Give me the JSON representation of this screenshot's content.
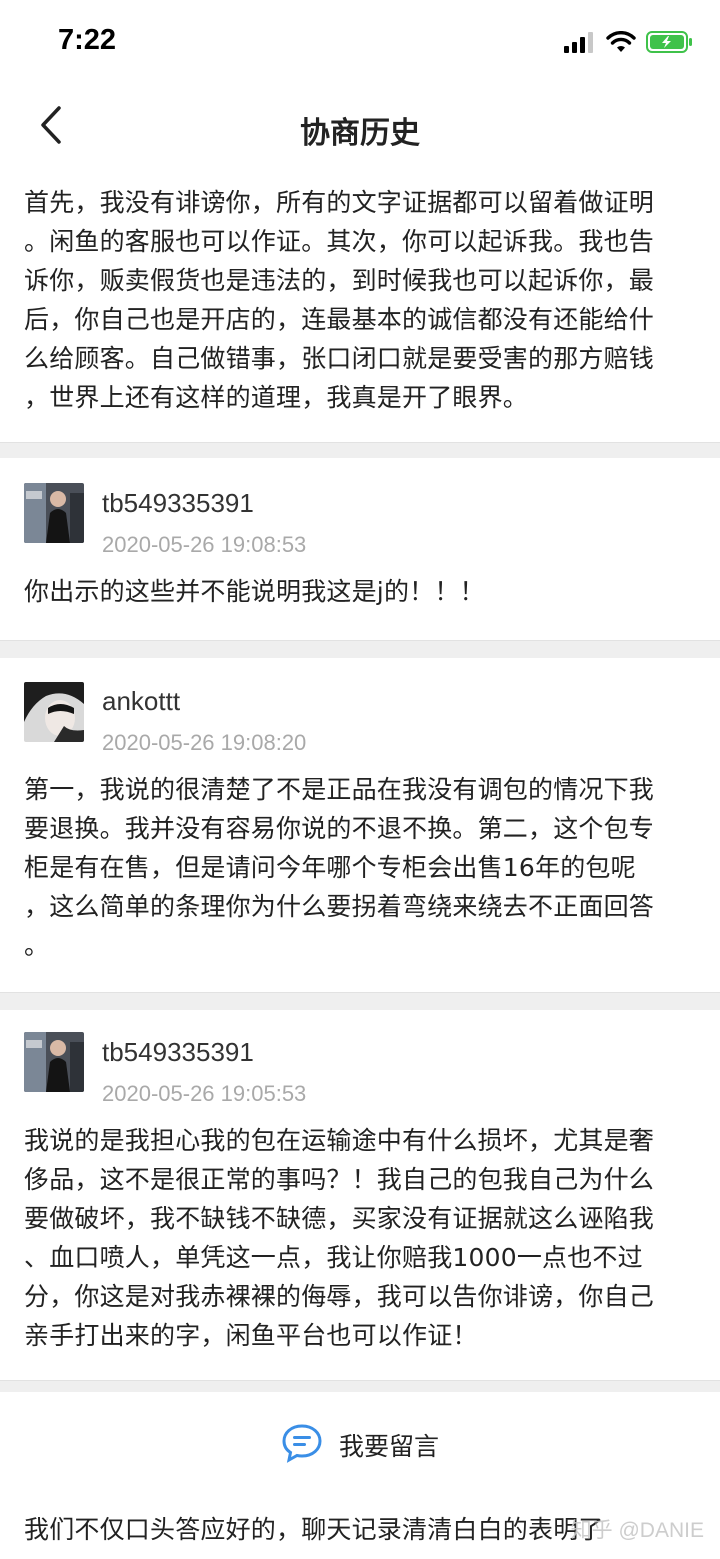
{
  "status_bar": {
    "time": "7:22",
    "signal_icon": "cellular-signal-icon",
    "wifi_icon": "wifi-icon",
    "battery_icon": "battery-charging-icon"
  },
  "nav": {
    "title": "协商历史",
    "back_icon": "chevron-left-icon"
  },
  "intro_text": "首先，我没有诽谤你，所有的文字证据都可以留着做证明\n。闲鱼的客服也可以作证。其次，你可以起诉我。我也告\n诉你，贩卖假货也是违法的，到时候我也可以起诉你，最\n后，你自己也是开店的，连最基本的诚信都没有还能给什\n么给顾客。自己做错事，张口闭口就是要受害的那方赔钱\n，世界上还有这样的道理，我真是开了眼界。",
  "messages": [
    {
      "user": "tb549335391",
      "time": "2020-05-26 19:08:53",
      "text": "你出示的这些并不能说明我这是j的！！！"
    },
    {
      "user": "ankottt",
      "time": "2020-05-26 19:08:20",
      "text": "第一，我说的很清楚了不是正品在我没有调包的情况下我\n要退换。我并没有容易你说的不退不换。第二，这个包专\n柜是有在售，但是请问今年哪个专柜会出售16年的包呢\n，这么简单的条理你为什么要拐着弯绕来绕去不正面回答\n。"
    },
    {
      "user": "tb549335391",
      "time": "2020-05-26 19:05:53",
      "text": "我说的是我担心我的包在运输途中有什么损坏，尤其是奢\n侈品，这不是很正常的事吗？！我自己的包我自己为什么\n要做破坏，我不缺钱不缺德，买家没有证据就这么诬陷我\n、血口喷人，单凭这一点，我让你赔我1000一点也不过\n分，你这是对我赤裸裸的侮辱，我可以告你诽谤，你自己\n亲手打出来的字，闲鱼平台也可以作证！"
    }
  ],
  "leave_message": {
    "label": "我要留言",
    "icon": "chat-bubble-icon"
  },
  "footer_text": "我们不仅口头答应好的，聊天记录清清白白的表明了",
  "watermark": "知乎 @DANIE",
  "colors": {
    "accent": "#3a8ee6",
    "separator": "#efefef",
    "timestamp": "#a9a9a9",
    "battery": "#3fc24a"
  }
}
